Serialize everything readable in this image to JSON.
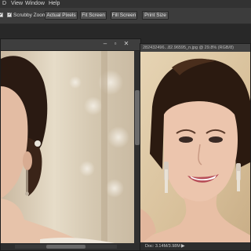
{
  "menubar": {
    "items": [
      {
        "label": "D"
      },
      {
        "label": "View"
      },
      {
        "label": "Window"
      },
      {
        "label": "Help"
      }
    ]
  },
  "options": {
    "check_all_windows": "✓",
    "check_scrubby_zoom": "✓",
    "scrubby_zoom_label": "Scrubby Zoom",
    "actual_pixels_label": "Actual Pixels",
    "fit_screen_label": "Fit Screen",
    "fill_screen_label": "Fill Screen",
    "print_size_label": "Print Size"
  },
  "doc_right": {
    "tab_label": "282432496...82.96595_n.jpg @ 29.8% (RGB/8)"
  },
  "status_right": {
    "doc_info": "Doc: 3.14M/3.98M",
    "arrow": "▶"
  },
  "icons": {
    "minimize": "minimize-icon",
    "maximize": "maximize-icon",
    "close": "close-icon"
  },
  "colors": {
    "menu_bg": "#323232",
    "options_bg": "#3c3c3c",
    "workspace_bg": "#282828",
    "button_bg": "#535353"
  }
}
